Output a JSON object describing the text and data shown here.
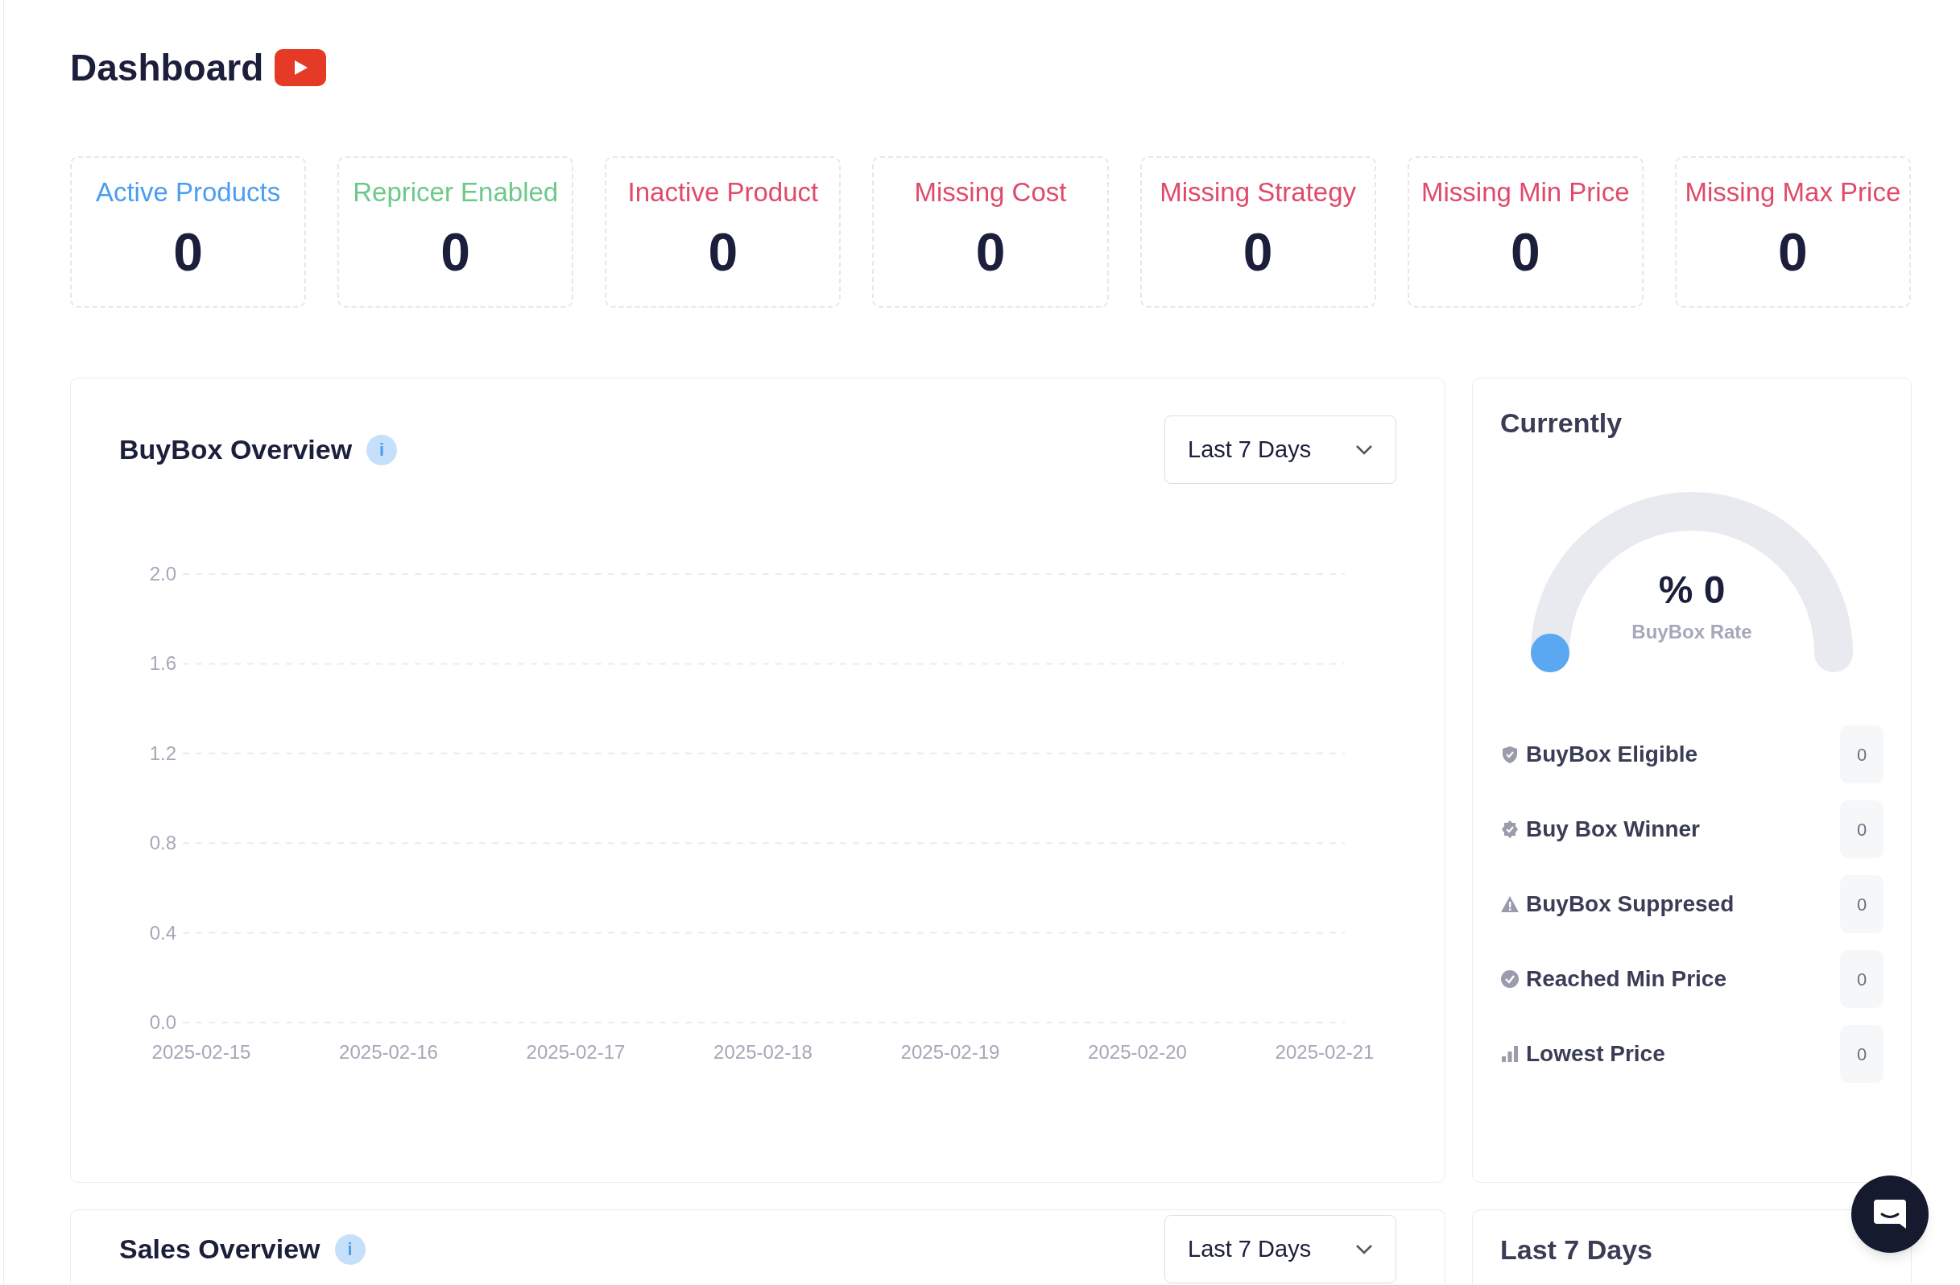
{
  "page": {
    "title": "Dashboard"
  },
  "stat_cards": [
    {
      "label": "Active Products",
      "value": "0",
      "color": "#4a9df0"
    },
    {
      "label": "Repricer Enabled",
      "value": "0",
      "color": "#6cc98a"
    },
    {
      "label": "Inactive Product",
      "value": "0",
      "color": "#e04a6a"
    },
    {
      "label": "Missing Cost",
      "value": "0",
      "color": "#e04a6a"
    },
    {
      "label": "Missing Strategy",
      "value": "0",
      "color": "#e04a6a"
    },
    {
      "label": "Missing Min Price",
      "value": "0",
      "color": "#e04a6a"
    },
    {
      "label": "Missing Max Price",
      "value": "0",
      "color": "#e04a6a"
    }
  ],
  "buybox_overview": {
    "title": "BuyBox Overview",
    "info": "i",
    "range": "Last 7 Days",
    "chart_data": {
      "type": "line",
      "grid": true,
      "categories": [
        "2025-02-15",
        "2025-02-16",
        "2025-02-17",
        "2025-02-18",
        "2025-02-19",
        "2025-02-20",
        "2025-02-21"
      ],
      "ylim": [
        0,
        2
      ],
      "yticks": [
        {
          "value": 0,
          "label": "0.0"
        },
        {
          "value": 0.4,
          "label": "0.4"
        },
        {
          "value": 0.8,
          "label": "0.8"
        },
        {
          "value": 1.2,
          "label": "1.2"
        },
        {
          "value": 1.6,
          "label": "1.6"
        },
        {
          "value": 2,
          "label": "2.0"
        }
      ]
    }
  },
  "currently": {
    "title": "Currently",
    "gauge": {
      "value": "% 0",
      "label": "BuyBox Rate",
      "level": 0
    },
    "items": [
      {
        "kind": "shield",
        "label": "BuyBox Eligible",
        "count": "0"
      },
      {
        "kind": "badge",
        "label": "Buy Box Winner",
        "count": "0"
      },
      {
        "kind": "warning",
        "label": "BuyBox Suppresed",
        "count": "0"
      },
      {
        "kind": "check",
        "label": "Reached Min Price",
        "count": "0"
      },
      {
        "kind": "bars",
        "label": "Lowest Price",
        "count": "0"
      }
    ]
  },
  "sales_overview": {
    "title": "Sales Overview",
    "info": "i",
    "range": "Last 7 Days"
  },
  "side_panel": {
    "title": "Last 7 Days"
  }
}
